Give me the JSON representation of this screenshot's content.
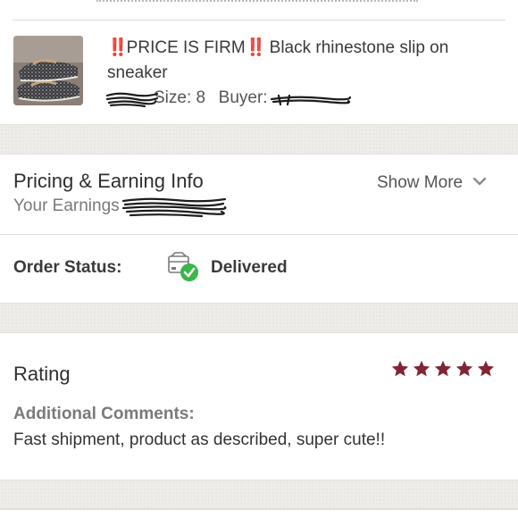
{
  "order_item": {
    "title_prefix": "‼️",
    "title_firm": "PRICE IS FIRM",
    "title_rest": "Black rhinestone slip on sneaker",
    "size_label": "Size:",
    "size_value": "8",
    "buyer_label": "Buyer:"
  },
  "pricing": {
    "heading": "Pricing & Earning Info",
    "earnings_label": "Your Earnings",
    "show_more_label": "Show More"
  },
  "order_status": {
    "label": "Order Status:",
    "value": "Delivered",
    "status_color": "#3bb54a"
  },
  "rating": {
    "heading": "Rating",
    "stars": 5,
    "max_stars": 5,
    "star_color": "#822433",
    "comments_label": "Additional Comments:",
    "comment": "Fast shipment, product as described, super cute!!"
  },
  "icons": {
    "chevron": "chevron-down-icon",
    "status": "package-delivered-icon",
    "star": "star-icon"
  }
}
